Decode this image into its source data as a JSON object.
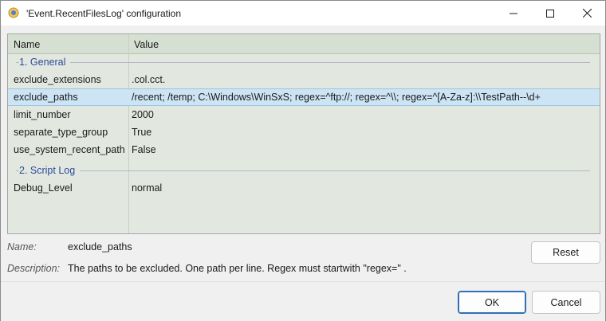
{
  "window": {
    "title": "'Event.RecentFilesLog' configuration"
  },
  "grid": {
    "columns": [
      "Name",
      "Value"
    ],
    "groups": [
      {
        "label": "1. General",
        "properties": [
          {
            "name": "exclude_extensions",
            "value": ".col.cct."
          },
          {
            "name": "exclude_paths",
            "value": "/recent; /temp; C:\\Windows\\WinSxS; regex=^ftp://; regex=^\\\\; regex=^[A-Za-z]:\\\\TestPath--\\d+",
            "selected": true
          },
          {
            "name": "limit_number",
            "value": "2000"
          },
          {
            "name": "separate_type_group",
            "value": "True"
          },
          {
            "name": "use_system_recent_path",
            "value": "False"
          }
        ]
      },
      {
        "label": "2. Script Log",
        "properties": [
          {
            "name": "Debug_Level",
            "value": "normal"
          }
        ]
      }
    ]
  },
  "info": {
    "name_label": "Name:",
    "name_value": "exclude_paths",
    "description_label": "Description:",
    "description_value": "The paths to be excluded. One path per line. Regex must startwith \"regex=\" ."
  },
  "buttons": {
    "reset": "Reset",
    "ok": "OK",
    "cancel": "Cancel"
  },
  "colors": {
    "accent": "#2f6fb8",
    "selection": "#cde4f4",
    "group_text": "#2e4a9a",
    "grid_bg": "#e2e8e0"
  }
}
